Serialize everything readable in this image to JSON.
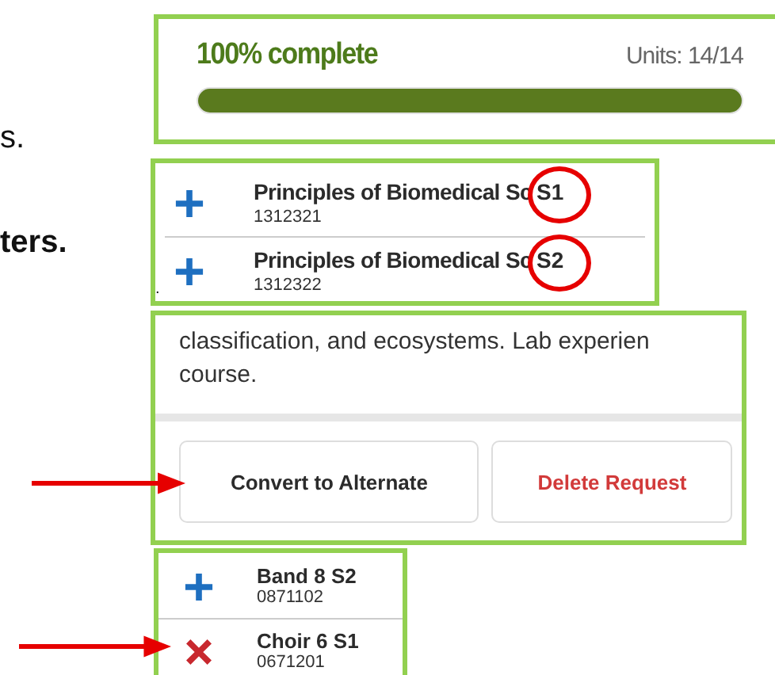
{
  "side_text": [
    {
      "text": "s.",
      "kind": "plain"
    },
    {
      "text": "ters.",
      "kind": "bold"
    },
    {
      "text": ".",
      "kind": "small"
    }
  ],
  "progress": {
    "label": "100% complete",
    "units": "Units: 14/14",
    "level": 1
  },
  "courses": [
    {
      "name": "Principles of Biomedical Sc",
      "section": "S1",
      "code": "1312321",
      "kind": "add",
      "highlighted": true
    },
    {
      "name": "Principles of Biomedical Sc",
      "section": "S2",
      "code": "1312322",
      "kind": "add",
      "highlighted": true
    }
  ],
  "description": {
    "lines": [
      "classification, and ecosystems. Lab experien",
      "course."
    ]
  },
  "buttons": [
    {
      "label": "Convert to Alternate",
      "kind": "default",
      "arrow": true
    },
    {
      "label": "Delete Request",
      "kind": "danger",
      "arrow": false
    }
  ],
  "requests": [
    {
      "name": "Band 8 S2",
      "code": "0871102",
      "kind": "add",
      "arrow": false
    },
    {
      "name": "Choir 6 S1",
      "code": "0671201",
      "kind": "drop",
      "arrow": true
    }
  ]
}
